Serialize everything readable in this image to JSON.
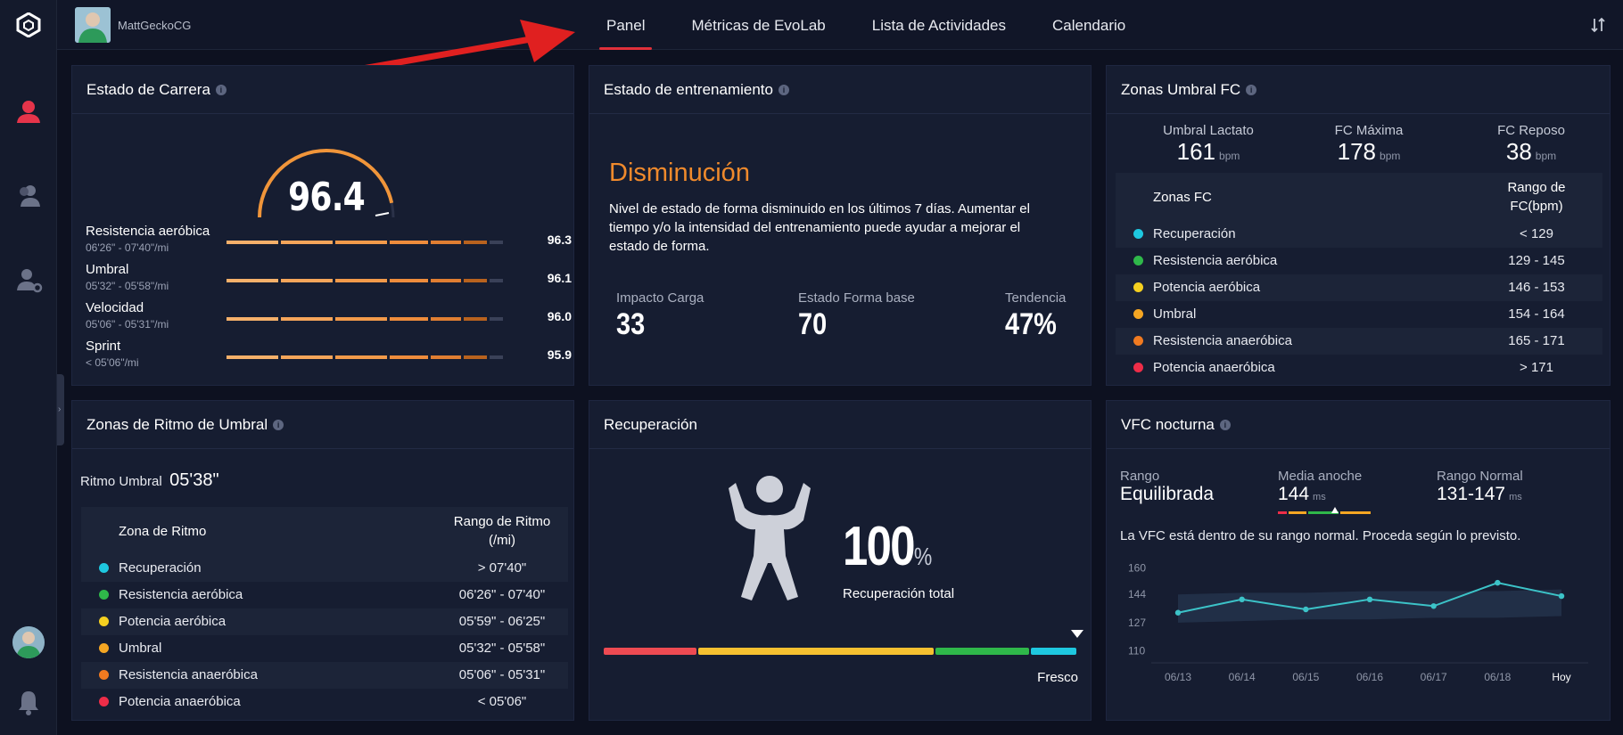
{
  "colors": {
    "accent_red": "#e0303a",
    "orange": "#f08a2c",
    "zone_recovery": "#1ec8e0",
    "zone_aerobic_endurance": "#2fb84a",
    "zone_aerobic_power": "#f5d020",
    "zone_threshold": "#f5a623",
    "zone_anaerobic_endurance": "#f07a20",
    "zone_anaerobic_power": "#ee2d48",
    "vfc_line": "#3cc3c8"
  },
  "icons": {
    "logo": "hexagon-logo-icon",
    "nav": [
      "user-profile-icon",
      "users-icon",
      "user-settings-icon"
    ],
    "bell": "bell-icon",
    "sort": "sort-toggle-icon",
    "info": "info-icon",
    "figure": "strong-person-icon"
  },
  "header": {
    "username": "MattGeckoCG",
    "tabs": [
      {
        "label": "Panel",
        "active": true
      },
      {
        "label": "Métricas de EvoLab",
        "active": false
      },
      {
        "label": "Lista de Actividades",
        "active": false
      },
      {
        "label": "Calendario",
        "active": false
      }
    ]
  },
  "race": {
    "title": "Estado de Carrera",
    "score": "96.4",
    "gauge_fraction": 0.93,
    "rows": [
      {
        "name": "Resistencia aeróbica",
        "pace": "06'26\" - 07'40\"/mi",
        "value": "96.3",
        "fraction": 0.963
      },
      {
        "name": "Umbral",
        "pace": "05'32\" - 05'58\"/mi",
        "value": "96.1",
        "fraction": 0.961
      },
      {
        "name": "Velocidad",
        "pace": "05'06\" - 05'31\"/mi",
        "value": "96.0",
        "fraction": 0.96
      },
      {
        "name": "Sprint",
        "pace": "< 05'06\"/mi",
        "value": "95.9",
        "fraction": 0.959
      }
    ]
  },
  "training": {
    "title": "Estado de entrenamiento",
    "status": "Disminución",
    "description": "Nivel de estado de forma disminuido en los últimos 7 días. Aumentar el tiempo y/o la intensidad del entrenamiento puede ayudar a mejorar el estado de forma.",
    "metrics": [
      {
        "label": "Impacto Carga",
        "value": "33"
      },
      {
        "label": "Estado Forma base",
        "value": "70"
      },
      {
        "label": "Tendencia",
        "value": "47%"
      }
    ]
  },
  "hr": {
    "title": "Zonas Umbral FC",
    "top": [
      {
        "label": "Umbral Lactato",
        "value": "161",
        "unit": "bpm"
      },
      {
        "label": "FC Máxima",
        "value": "178",
        "unit": "bpm"
      },
      {
        "label": "FC Reposo",
        "value": "38",
        "unit": "bpm"
      }
    ],
    "col1": "Zonas FC",
    "col2": "Rango de FC(bpm)",
    "rows": [
      {
        "zone": "Recuperación",
        "range": "< 129",
        "color": "#1ec8e0"
      },
      {
        "zone": "Resistencia aeróbica",
        "range": "129 - 145",
        "color": "#2fb84a"
      },
      {
        "zone": "Potencia aeróbica",
        "range": "146 - 153",
        "color": "#f5d020"
      },
      {
        "zone": "Umbral",
        "range": "154 - 164",
        "color": "#f5a623"
      },
      {
        "zone": "Resistencia anaeróbica",
        "range": "165 - 171",
        "color": "#f07a20"
      },
      {
        "zone": "Potencia anaeróbica",
        "range": "> 171",
        "color": "#ee2d48"
      }
    ]
  },
  "pace": {
    "title": "Zonas de Ritmo de Umbral",
    "threshold_label": "Ritmo Umbral",
    "threshold_value": "05'38\"",
    "col1": "Zona de Ritmo",
    "col2": "Rango de Ritmo (/mi)",
    "rows": [
      {
        "zone": "Recuperación",
        "range": "> 07'40\"",
        "color": "#1ec8e0"
      },
      {
        "zone": "Resistencia aeróbica",
        "range": "06'26\" - 07'40\"",
        "color": "#2fb84a"
      },
      {
        "zone": "Potencia aeróbica",
        "range": "05'59\" - 06'25\"",
        "color": "#f5d020"
      },
      {
        "zone": "Umbral",
        "range": "05'32\" - 05'58\"",
        "color": "#f5a623"
      },
      {
        "zone": "Resistencia anaeróbica",
        "range": "05'06\" - 05'31\"",
        "color": "#f07a20"
      },
      {
        "zone": "Potencia anaeróbica",
        "range": "< 05'06\"",
        "color": "#ee2d48"
      }
    ]
  },
  "recovery": {
    "title": "Recuperación",
    "value": "100",
    "unit": "%",
    "label": "Recuperación total",
    "state": "Fresco",
    "segments": [
      {
        "color": "#ee4a52",
        "share": 0.2
      },
      {
        "color": "#f5c030",
        "share": 0.5
      },
      {
        "color": "#2fb84a",
        "share": 0.2
      },
      {
        "color": "#1ec8e0",
        "share": 0.1
      }
    ]
  },
  "vfc": {
    "title": "VFC nocturna",
    "stats": [
      {
        "label": "Rango",
        "value": "Equilibrada",
        "unit": ""
      },
      {
        "label": "Media anoche",
        "value": "144",
        "unit": "ms"
      },
      {
        "label": "Rango Normal",
        "value": "131-147",
        "unit": "ms"
      }
    ],
    "note": "La VFC está dentro de su rango normal. Proceda según lo previsto."
  },
  "chart_data": {
    "type": "line",
    "x": [
      "06/13",
      "06/14",
      "06/15",
      "06/16",
      "06/17",
      "06/18",
      "Hoy"
    ],
    "series": [
      {
        "values": [
          133,
          141,
          135,
          141,
          137,
          151,
          143
        ]
      }
    ],
    "band_low": [
      127,
      128,
      129,
      129,
      130,
      130,
      131
    ],
    "band_high": [
      144,
      145,
      145,
      146,
      146,
      146,
      147
    ],
    "yticks": [
      110,
      127,
      144,
      160
    ],
    "ylim": [
      105,
      165
    ],
    "grid": false
  }
}
